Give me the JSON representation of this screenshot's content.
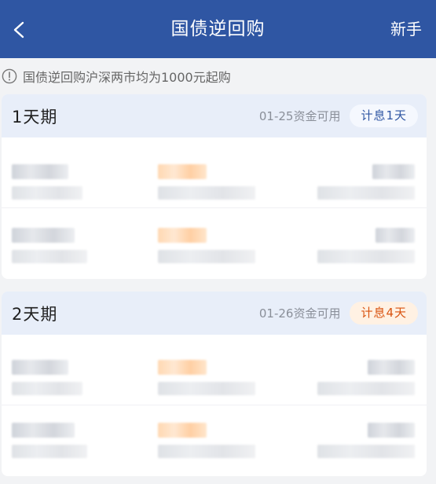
{
  "navbar": {
    "title": "国债逆回购",
    "right_label": "新手",
    "back_icon": "chevron-left-icon"
  },
  "notice": {
    "icon": "info-circle-icon",
    "text": "国债逆回购沪深两市均为1000元起购"
  },
  "cards": [
    {
      "term": "1天期",
      "availability": "01-25资金可用",
      "badge": "计息1天",
      "badge_color": "#2f56a3"
    },
    {
      "term": "2天期",
      "availability": "01-26资金可用",
      "badge": "计息4天",
      "badge_color": "#d9530f"
    }
  ],
  "colors": {
    "navbar_bg": "#2f56a3",
    "card_header_bg": "#e8eef9",
    "page_bg": "#f2f3f5"
  }
}
